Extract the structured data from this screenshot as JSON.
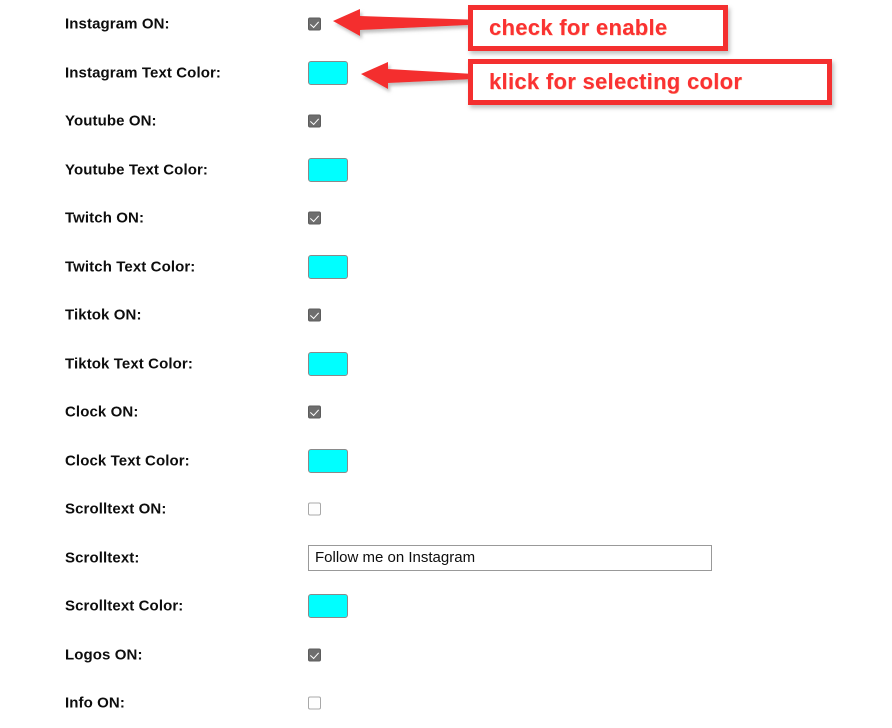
{
  "page": {
    "background_color": "#ffffff",
    "label_color": "#0d0d0d"
  },
  "theme": {
    "swatch_color": "#00ffff",
    "annotation_color": "#fa3232",
    "annotation_border_color": "#f42f2f",
    "checkbox_checked_color": "#6e6e6e",
    "checkbox_border_color": "#a8a8a8",
    "input_border_color": "#999999"
  },
  "form": {
    "rows": [
      {
        "label": "Instagram ON:",
        "control": "checkbox",
        "checked": true,
        "icon": "checkbox-checked-icon"
      },
      {
        "label": "Instagram Text Color:",
        "control": "color",
        "value": "#00ffff",
        "icon": "color-swatch-icon"
      },
      {
        "label": "Youtube ON:",
        "control": "checkbox",
        "checked": true,
        "icon": "checkbox-checked-icon"
      },
      {
        "label": "Youtube Text Color:",
        "control": "color",
        "value": "#00ffff",
        "icon": "color-swatch-icon"
      },
      {
        "label": "Twitch ON:",
        "control": "checkbox",
        "checked": true,
        "icon": "checkbox-checked-icon"
      },
      {
        "label": "Twitch Text Color:",
        "control": "color",
        "value": "#00ffff",
        "icon": "color-swatch-icon"
      },
      {
        "label": "Tiktok ON:",
        "control": "checkbox",
        "checked": true,
        "icon": "checkbox-checked-icon"
      },
      {
        "label": "Tiktok Text Color:",
        "control": "color",
        "value": "#00ffff",
        "icon": "color-swatch-icon"
      },
      {
        "label": "Clock ON:",
        "control": "checkbox",
        "checked": true,
        "icon": "checkbox-checked-icon"
      },
      {
        "label": "Clock Text Color:",
        "control": "color",
        "value": "#00ffff",
        "icon": "color-swatch-icon"
      },
      {
        "label": "Scrolltext ON:",
        "control": "checkbox",
        "checked": false,
        "icon": "checkbox-unchecked-icon"
      },
      {
        "label": "Scrolltext:",
        "control": "text",
        "value": "Follow me on Instagram",
        "placeholder": ""
      },
      {
        "label": "Scrolltext Color:",
        "control": "color",
        "value": "#00ffff",
        "icon": "color-swatch-icon"
      },
      {
        "label": "Logos ON:",
        "control": "checkbox",
        "checked": true,
        "icon": "checkbox-checked-icon"
      },
      {
        "label": "Info ON:",
        "control": "checkbox",
        "checked": false,
        "icon": "checkbox-unchecked-icon"
      }
    ]
  },
  "annotations": {
    "enable": {
      "text": "check for enable",
      "arrow": "arrow-left-icon"
    },
    "color": {
      "text": "klick for selecting color",
      "arrow": "arrow-left-icon"
    }
  }
}
